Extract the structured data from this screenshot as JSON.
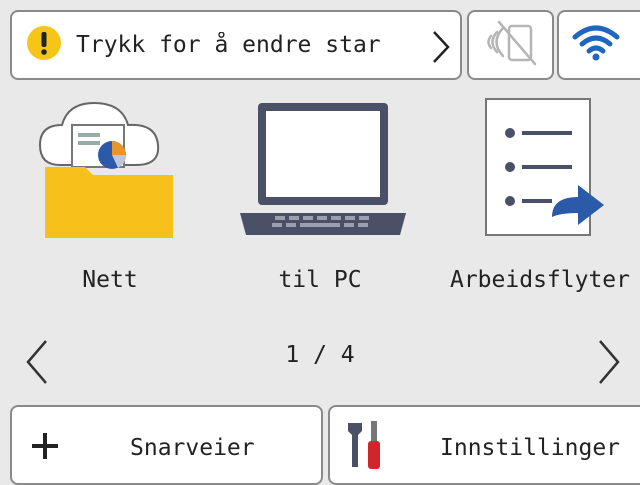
{
  "status_bar": {
    "message": "Trykk for å endre star",
    "warning_color": "#f5c518"
  },
  "apps": [
    {
      "label": "Nett",
      "icon": "web-cloud-folder-icon"
    },
    {
      "label": "til PC",
      "icon": "laptop-icon"
    },
    {
      "label": "Arbeidsflyter",
      "icon": "workflow-list-icon"
    }
  ],
  "pagination": {
    "text": "1 / 4"
  },
  "bottom_bar": {
    "shortcuts_label": "Snarveier",
    "settings_label": "Innstillinger"
  },
  "colors": {
    "background": "#e9e9e9",
    "folder_yellow": "#f7c11b",
    "accent_blue": "#2a5aa8",
    "dark_slate": "#4a5066",
    "tool_red": "#d0262a"
  }
}
